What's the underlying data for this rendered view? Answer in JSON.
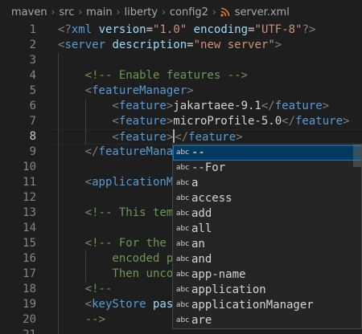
{
  "breadcrumb": {
    "items": [
      "maven",
      "src",
      "main",
      "liberty",
      "config2"
    ],
    "file": "server.xml"
  },
  "editor": {
    "active_line": "8",
    "lines": [
      {
        "n": "1",
        "indent": 0,
        "tokens": [
          [
            "c-punct",
            "<?"
          ],
          [
            "c-tag",
            "xml"
          ],
          [
            "c-text",
            " "
          ],
          [
            "c-attr",
            "version"
          ],
          [
            "c-text",
            "="
          ],
          [
            "c-str",
            "\"1.0\""
          ],
          [
            "c-text",
            " "
          ],
          [
            "c-attr",
            "encoding"
          ],
          [
            "c-text",
            "="
          ],
          [
            "c-str",
            "\"UTF-8\""
          ],
          [
            "c-punct",
            "?>"
          ]
        ]
      },
      {
        "n": "2",
        "indent": 0,
        "tokens": [
          [
            "c-punct",
            "<"
          ],
          [
            "c-tag",
            "server"
          ],
          [
            "c-text",
            " "
          ],
          [
            "c-attr",
            "description"
          ],
          [
            "c-text",
            "="
          ],
          [
            "c-str",
            "\"new server\""
          ],
          [
            "c-punct",
            ">"
          ]
        ]
      },
      {
        "n": "3",
        "indent": 1,
        "tokens": []
      },
      {
        "n": "4",
        "indent": 1,
        "tokens": [
          [
            "c-comment",
            "<!-- Enable features -->"
          ]
        ]
      },
      {
        "n": "5",
        "indent": 1,
        "tokens": [
          [
            "c-punct",
            "<"
          ],
          [
            "c-tag",
            "featureManager"
          ],
          [
            "c-punct",
            ">"
          ]
        ]
      },
      {
        "n": "6",
        "indent": 2,
        "tokens": [
          [
            "c-punct",
            "<"
          ],
          [
            "c-tag",
            "feature"
          ],
          [
            "c-punct",
            ">"
          ],
          [
            "c-text",
            "jakartaee-9.1"
          ],
          [
            "c-punct",
            "</"
          ],
          [
            "c-tag",
            "feature"
          ],
          [
            "c-punct",
            ">"
          ]
        ]
      },
      {
        "n": "7",
        "indent": 2,
        "tokens": [
          [
            "c-punct",
            "<"
          ],
          [
            "c-tag",
            "feature"
          ],
          [
            "c-punct",
            ">"
          ],
          [
            "c-text",
            "microProfile-5.0"
          ],
          [
            "c-punct",
            "</"
          ],
          [
            "c-tag",
            "feature"
          ],
          [
            "c-punct",
            ">"
          ]
        ]
      },
      {
        "n": "8",
        "indent": 2,
        "tokens": [
          [
            "c-punct",
            "<"
          ],
          [
            "c-tag",
            "feature"
          ],
          [
            "c-punct",
            ">"
          ],
          [
            "cursor",
            ""
          ],
          [
            "c-punct",
            "</"
          ],
          [
            "c-tag",
            "feature"
          ],
          [
            "c-punct",
            ">"
          ]
        ]
      },
      {
        "n": "9",
        "indent": 1,
        "tokens": [
          [
            "c-punct",
            "</"
          ],
          [
            "c-tag",
            "featureManager"
          ],
          [
            "c-punct",
            ">"
          ]
        ]
      },
      {
        "n": "10",
        "indent": 1,
        "tokens": []
      },
      {
        "n": "11",
        "indent": 1,
        "tokens": [
          [
            "c-punct",
            "<"
          ],
          [
            "c-tag",
            "applicationManager"
          ]
        ]
      },
      {
        "n": "12",
        "indent": 1,
        "tokens": []
      },
      {
        "n": "13",
        "indent": 1,
        "tokens": [
          [
            "c-comment",
            "<!-- This template"
          ]
        ]
      },
      {
        "n": "14",
        "indent": 1,
        "tokens": []
      },
      {
        "n": "15",
        "indent": 1,
        "tokens": [
          [
            "c-comment",
            "<!-- For the keystore"
          ]
        ]
      },
      {
        "n": "16",
        "indent": 2,
        "tokens": [
          [
            "c-comment",
            "encoded password"
          ]
        ]
      },
      {
        "n": "17",
        "indent": 2,
        "tokens": [
          [
            "c-comment",
            "Then uncomment"
          ]
        ]
      },
      {
        "n": "18",
        "indent": 1,
        "tokens": [
          [
            "c-comment",
            "<!--"
          ]
        ]
      },
      {
        "n": "19",
        "indent": 1,
        "tokens": [
          [
            "c-punct",
            "<"
          ],
          [
            "c-tag",
            "keyStore"
          ],
          [
            "c-text",
            " "
          ],
          [
            "c-attr",
            "password"
          ]
        ]
      },
      {
        "n": "20",
        "indent": 1,
        "tokens": [
          [
            "c-comment",
            "-->"
          ]
        ]
      },
      {
        "n": "21",
        "indent": 1,
        "tokens": []
      }
    ]
  },
  "suggest": {
    "icon_label": "abc",
    "items": [
      "--",
      "--For",
      "a",
      "access",
      "add",
      "all",
      "an",
      "and",
      "app-name",
      "application",
      "applicationManager",
      "are"
    ],
    "selected_index": 0
  }
}
